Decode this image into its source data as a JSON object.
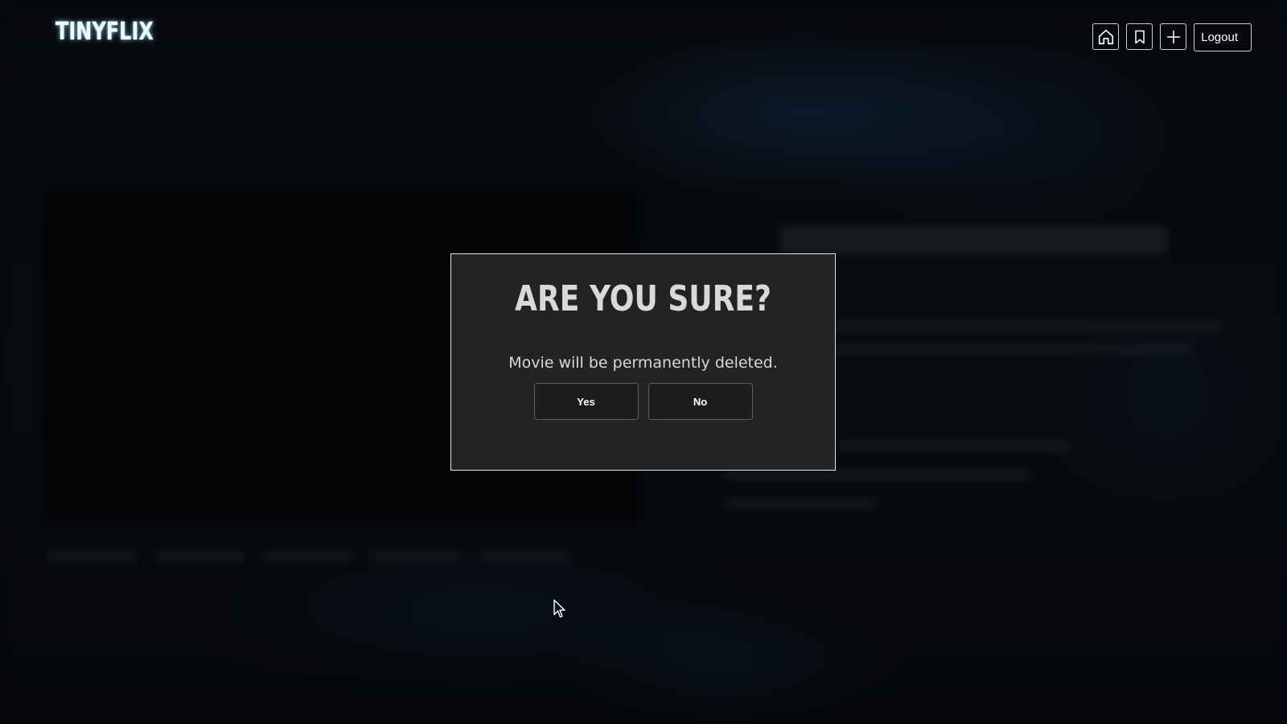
{
  "app": {
    "logo": "TINYFLIX"
  },
  "nav": {
    "home_icon": "home-icon",
    "bookmark_icon": "bookmark-icon",
    "add_icon": "plus-icon",
    "logout_label": "Logout"
  },
  "modal": {
    "title": "ARE YOU SURE?",
    "message": "Movie will be permanently deleted.",
    "yes_label": "Yes",
    "no_label": "No"
  },
  "colors": {
    "background": "#0b0e12",
    "modal_bg": "#222325",
    "modal_border": "#e6e6e6",
    "logo_glow": "#a0e6ff",
    "text": "#d9d9d9"
  }
}
